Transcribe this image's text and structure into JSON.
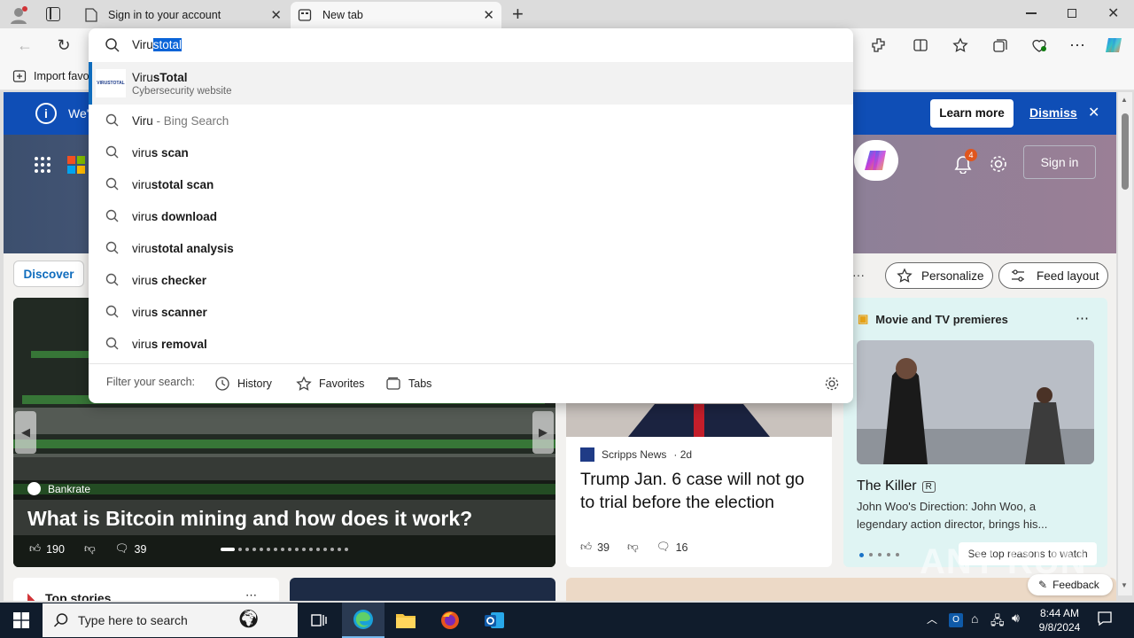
{
  "browser": {
    "tabs": [
      {
        "label": "Sign in to your account"
      },
      {
        "label": "New tab"
      }
    ],
    "window_controls": [
      "minimize",
      "restore",
      "close"
    ]
  },
  "address_bar": {
    "typed": "Viru",
    "autocomplete": "stotal"
  },
  "favorites_bar": {
    "import_label": "Import favo"
  },
  "suggestions": {
    "top_site": {
      "prefix": "Viru",
      "bold": "sTotal",
      "subtitle": "Cybersecurity website",
      "logo_text": "VIRUSTOTAL"
    },
    "bing": {
      "text": "Viru",
      "suffix": " - Bing Search"
    },
    "items": [
      {
        "prefix": "viru",
        "bold": "s scan"
      },
      {
        "prefix": "viru",
        "bold": "stotal scan"
      },
      {
        "prefix": "viru",
        "bold": "s download"
      },
      {
        "prefix": "viru",
        "bold": "stotal analysis"
      },
      {
        "prefix": "viru",
        "bold": "s checker"
      },
      {
        "prefix": "viru",
        "bold": "s scanner"
      },
      {
        "prefix": "viru",
        "bold": "s removal"
      }
    ],
    "filter_label": "Filter your search:",
    "filters": [
      "History",
      "Favorites",
      "Tabs"
    ]
  },
  "infobar": {
    "text": "We'",
    "learn_more": "Learn more",
    "dismiss": "Dismiss"
  },
  "header": {
    "notification_count": "4",
    "sign_in": "Sign in"
  },
  "feed_nav": {
    "discover": "Discover",
    "more": "···",
    "personalize": "Personalize",
    "feed_layout": "Feed layout"
  },
  "main_card": {
    "source": "Bankrate",
    "headline": "What is Bitcoin mining and how does it work?",
    "likes": "190",
    "comments": "39"
  },
  "news_card": {
    "source": "Scripps News",
    "age": "· 2d",
    "headline": "Trump Jan. 6 case will not go to trial before the election",
    "likes": "39",
    "comments": "16"
  },
  "movie_card": {
    "section": "Movie and TV premieres",
    "title": "The Killer",
    "rating": "R",
    "description": "John Woo's Direction: John Woo, a legendary action director, brings his...",
    "cta": "See top reasons to watch"
  },
  "bottom": {
    "top_stories": "Top stories",
    "feedback": "Feedback"
  },
  "watermark": "ANY RUN",
  "taskbar": {
    "search_placeholder": "Type here to search",
    "time": "8:44 AM",
    "date": "9/8/2024"
  },
  "colors": {
    "infobar": "#0f4eb6",
    "accent": "#0f6cbd",
    "taskbar": "#101c2c",
    "selection": "#0a64d8"
  }
}
